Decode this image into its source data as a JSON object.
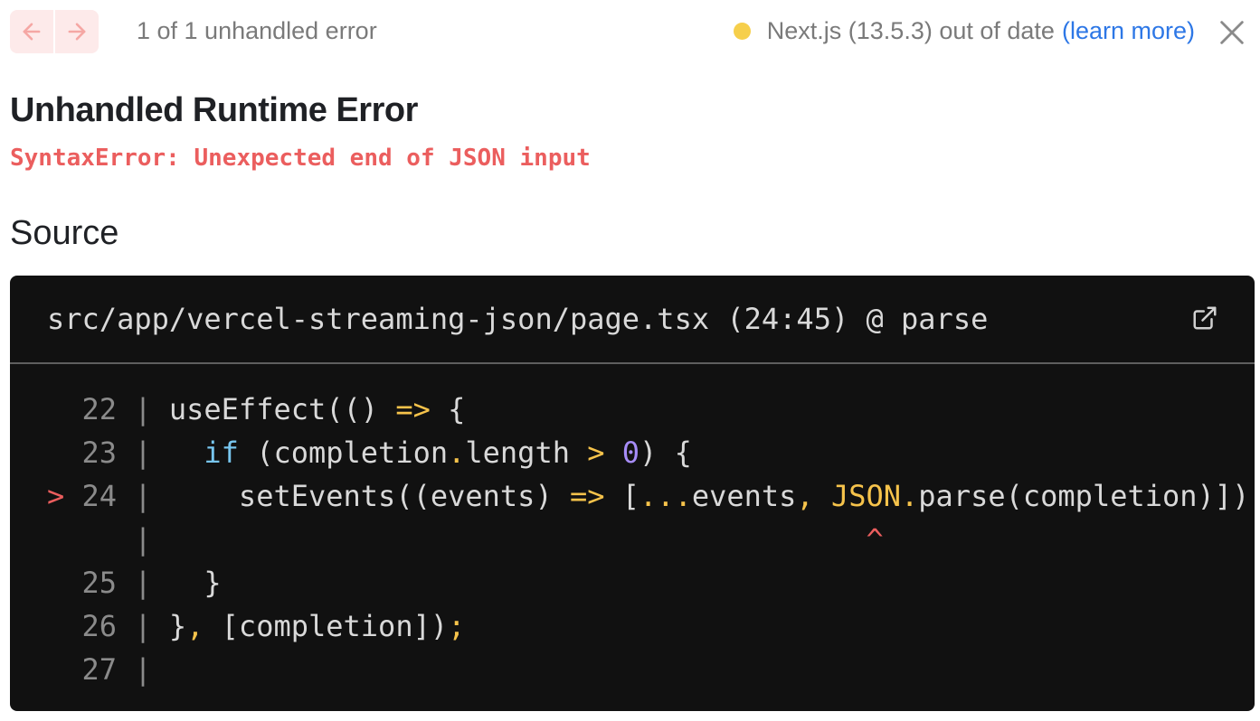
{
  "topbar": {
    "prev_label": "Previous error",
    "next_label": "Next error",
    "error_count": "1 of 1 unhandled error",
    "version_text": "Next.js (13.5.3) out of date",
    "learn_more": "(learn more)",
    "status_color": "#f6cf4b",
    "close_label": "Close"
  },
  "error": {
    "title": "Unhandled Runtime Error",
    "message": "SyntaxError: Unexpected end of JSON input"
  },
  "source": {
    "heading": "Source",
    "file": "src/app/vercel-streaming-json/page.tsx (24:45) @ parse",
    "lines": [
      {
        "num": "22",
        "text": "useEffect(() => {"
      },
      {
        "num": "23",
        "text": "  if (completion.length > 0) {"
      },
      {
        "num": "24",
        "text": "    setEvents((events) => [...events, JSON.parse(completion)]);",
        "highlighted": true
      },
      {
        "num": "",
        "text": "^",
        "caret": true
      },
      {
        "num": "25",
        "text": "  }"
      },
      {
        "num": "26",
        "text": "}, [completion]);"
      },
      {
        "num": "27",
        "text": ""
      }
    ]
  }
}
